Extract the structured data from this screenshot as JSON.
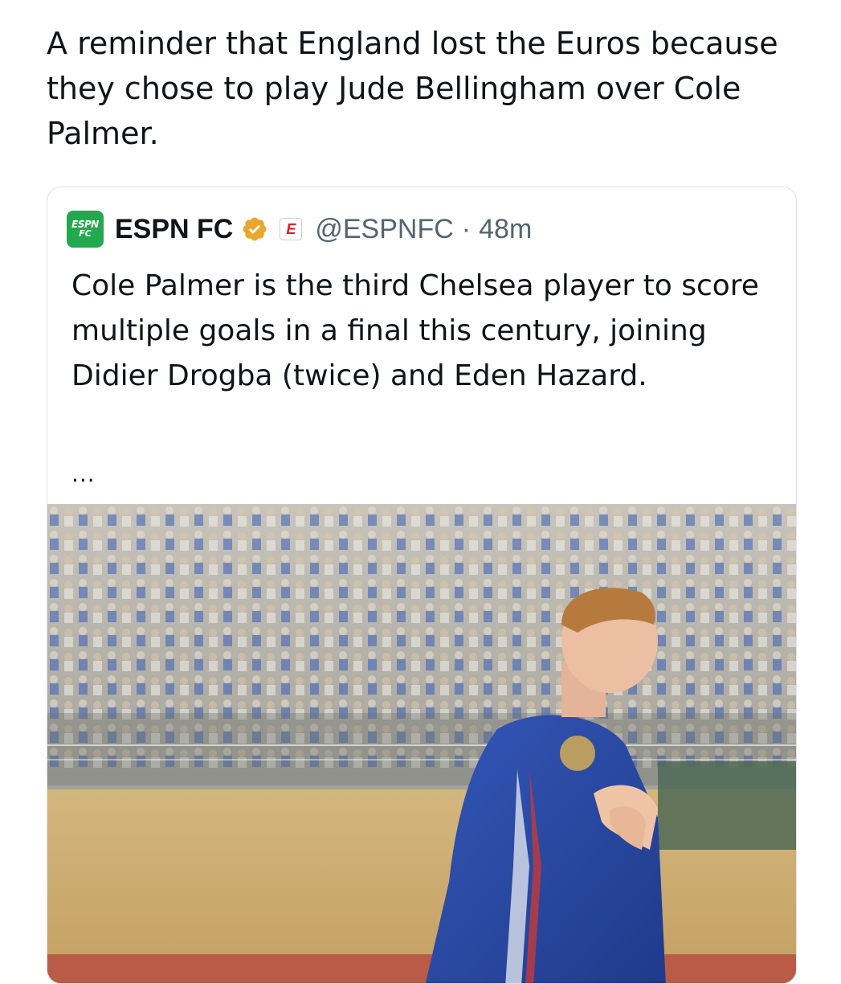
{
  "tweet": {
    "text": "A reminder that England lost the Euros because they chose to play Jude Bellingham over Cole Palmer."
  },
  "quoted_tweet": {
    "logo_text_top": "ESPN",
    "logo_text_bottom": "FC",
    "display_name": "ESPN FC",
    "affiliate_badge": "E",
    "handle": "@ESPNFC",
    "separator": "·",
    "timestamp": "48m",
    "text": "Cole Palmer is the third Chelsea player to score multiple goals in a final this century, joining Didier Drogba (twice) and Eden Hazard.",
    "show_more": "...",
    "media_description_icon": "photo-icon"
  },
  "colors": {
    "verified_gold": "#e8a72c",
    "espn_green": "#22a94f",
    "espn_red": "#d5202f",
    "secondary_text": "#536471"
  }
}
